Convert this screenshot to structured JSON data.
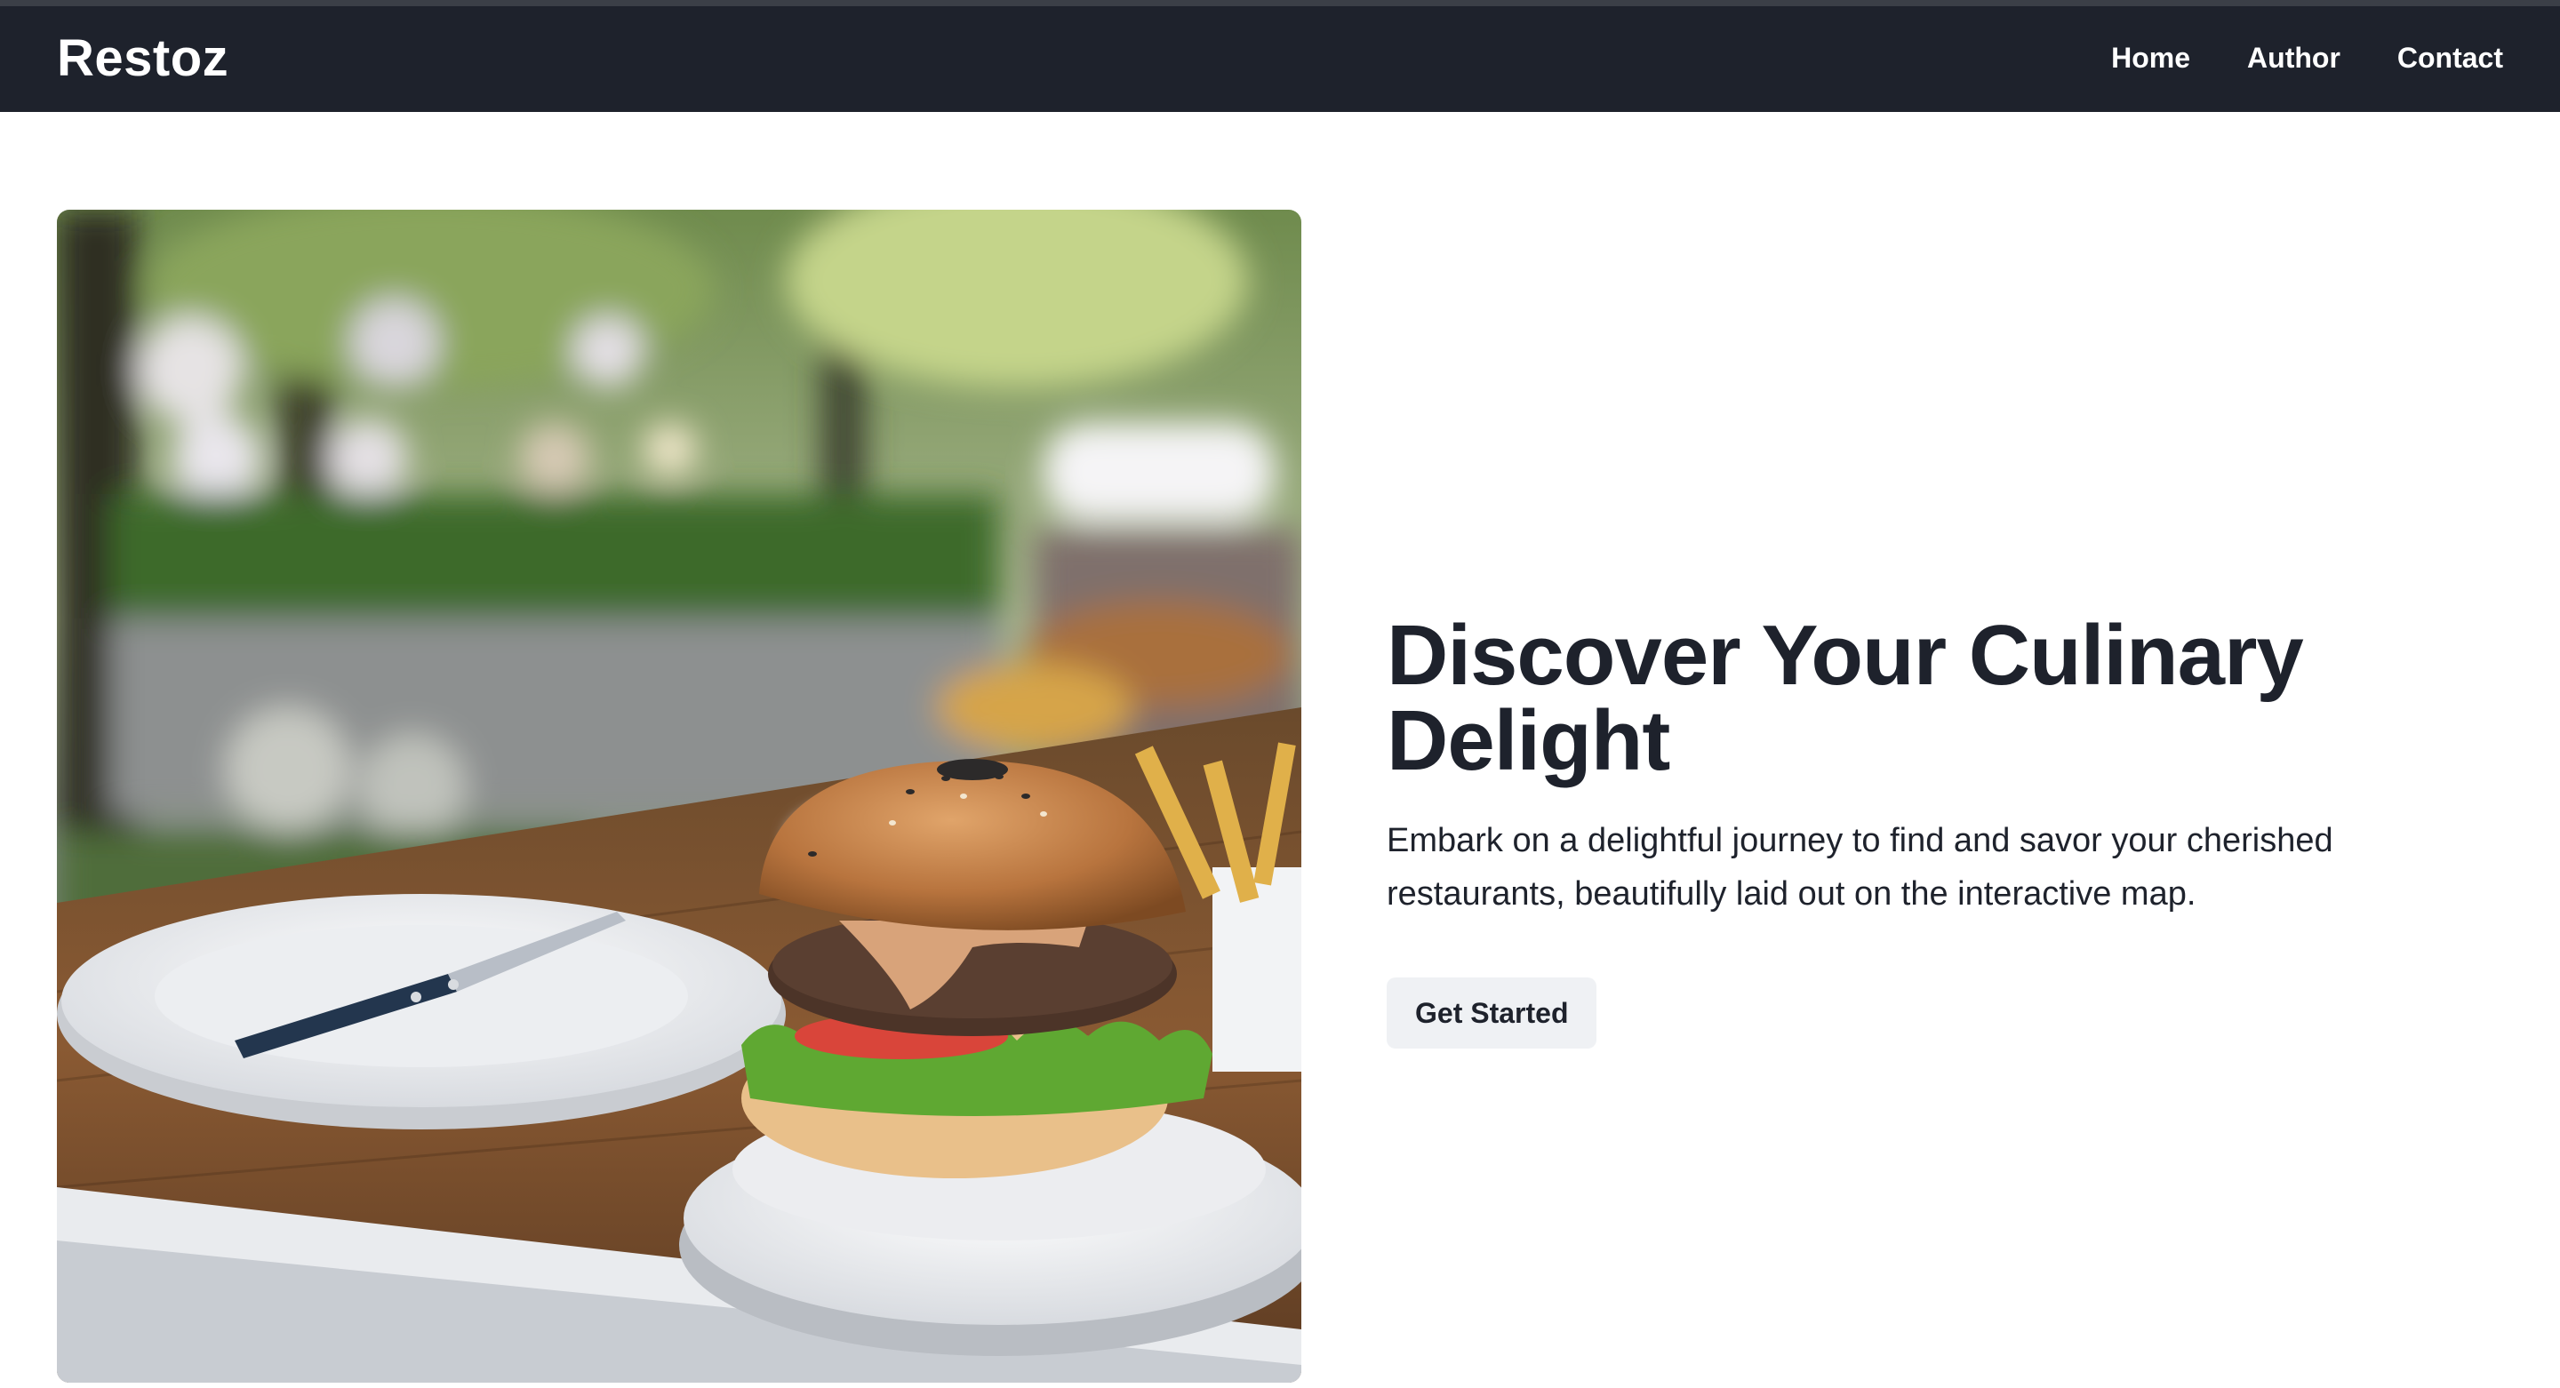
{
  "brand": "Restoz",
  "nav": {
    "items": [
      "Home",
      "Author",
      "Contact"
    ]
  },
  "hero": {
    "title": "Discover Your Culinary Delight",
    "subtitle": "Embark on a delightful journey to find and savor your cherished restaurants, beautifully laid out on the interactive map.",
    "cta_label": "Get Started",
    "image_subject": "burger-on-outdoor-table"
  },
  "colors": {
    "navbar_bg": "#1e222c",
    "text_dark": "#1e222c",
    "button_bg": "#eff1f4"
  }
}
